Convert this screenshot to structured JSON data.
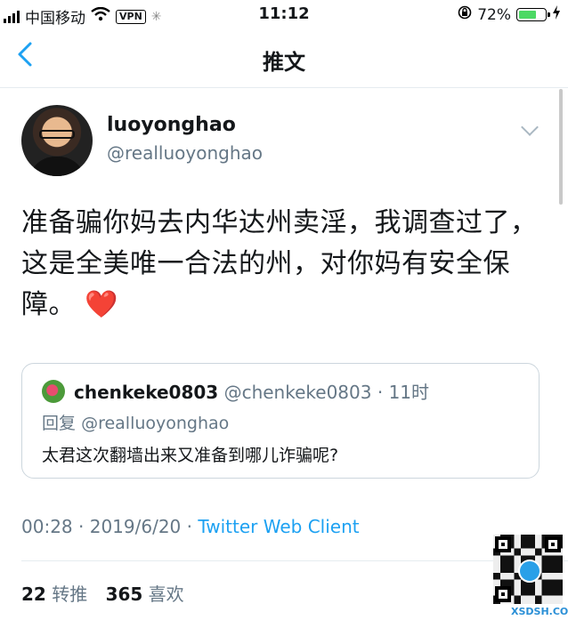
{
  "status_bar": {
    "carrier": "中国移动",
    "vpn": "VPN",
    "time": "11:12",
    "battery": "72%",
    "battery_level": 0.72
  },
  "navbar": {
    "title": "推文",
    "back_icon": "chevron-left-icon"
  },
  "tweet": {
    "display_name": "luoyonghao",
    "handle": "@realluoyonghao",
    "text": "准备骗你妈去内华达州卖淫，我调查过了，这是全美唯一合法的州，对你妈有安全保障。",
    "emoji": "❤️",
    "quote": {
      "name": "chenkeke0803",
      "handle": "@chenkeke0803",
      "separator": "·",
      "time": "11时",
      "reply_prefix": "回复",
      "reply_to": "@realluoyonghao",
      "text": "太君这次翻墙出来又准备到哪儿诈骗呢?"
    },
    "meta": {
      "time": "00:28",
      "sep1": "·",
      "date": "2019/6/20",
      "sep2": "·",
      "client": "Twitter Web Client"
    },
    "stats": {
      "retweets": "22",
      "retweets_label": "转推",
      "likes": "365",
      "likes_label": "喜欢"
    }
  },
  "watermark": "XSDSH.COM",
  "colors": {
    "accent": "#1da1f2",
    "secondary_text": "#657786",
    "heart": "#e0245e"
  }
}
